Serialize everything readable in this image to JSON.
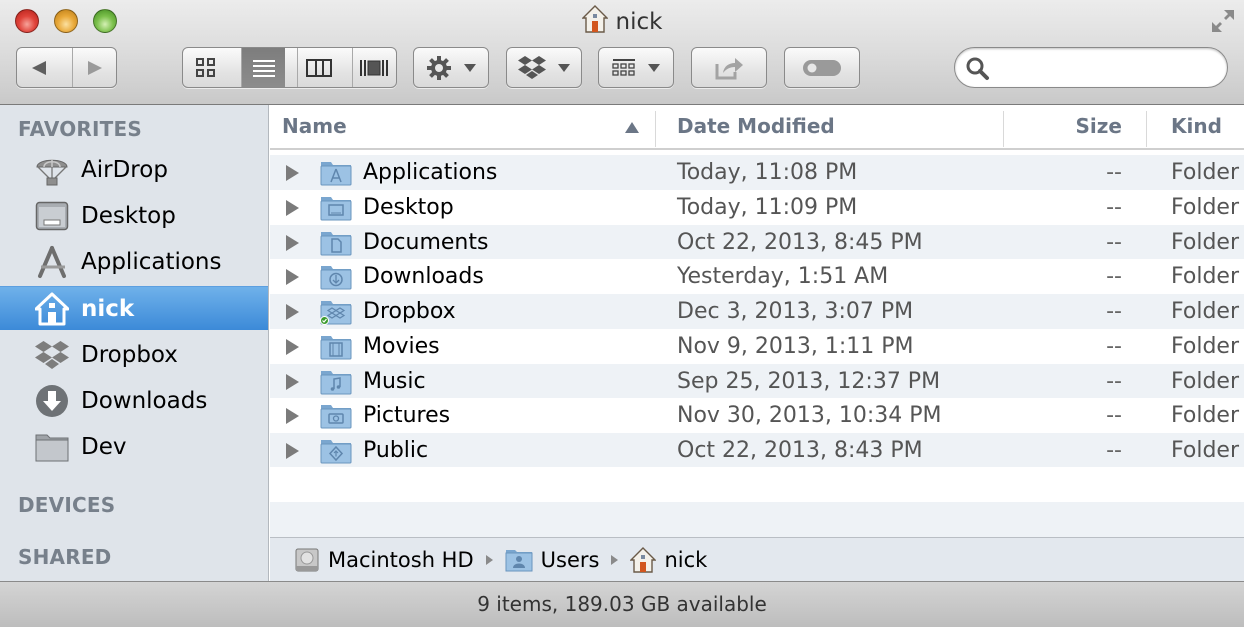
{
  "window": {
    "title": "nick",
    "title_icon": "home-icon"
  },
  "toolbar": {
    "back_icon": "back-arrow-icon",
    "forward_icon": "forward-arrow-icon",
    "view_modes": [
      {
        "name": "icon-view",
        "icon": "grid-icon",
        "active": false
      },
      {
        "name": "list-view",
        "icon": "list-icon",
        "active": true
      },
      {
        "name": "column-view",
        "icon": "columns-icon",
        "active": false
      },
      {
        "name": "cover-flow-view",
        "icon": "cover-flow-icon",
        "active": false
      }
    ],
    "action_menu_icon": "gear-icon",
    "dropbox_menu_icon": "dropbox-icon",
    "arrange_menu_icon": "arrange-grid-icon",
    "share_icon": "share-icon",
    "tags_icon": "toggle-pill-icon",
    "search": {
      "placeholder": "",
      "value": ""
    }
  },
  "sidebar": {
    "sections": {
      "favorites": "FAVORITES",
      "devices": "DEVICES",
      "shared": "SHARED"
    },
    "items": [
      {
        "label": "AirDrop",
        "icon": "airdrop-icon",
        "selected": false
      },
      {
        "label": "Desktop",
        "icon": "desktop-icon",
        "selected": false
      },
      {
        "label": "Applications",
        "icon": "applications-icon",
        "selected": false
      },
      {
        "label": "nick",
        "icon": "home-icon",
        "selected": true
      },
      {
        "label": "Dropbox",
        "icon": "dropbox-icon",
        "selected": false
      },
      {
        "label": "Downloads",
        "icon": "downloads-icon",
        "selected": false
      },
      {
        "label": "Dev",
        "icon": "folder-icon",
        "selected": false
      }
    ]
  },
  "list": {
    "columns": {
      "name": "Name",
      "date_modified": "Date Modified",
      "size": "Size",
      "kind": "Kind"
    },
    "sort": {
      "column": "name",
      "direction": "ascending"
    },
    "rows": [
      {
        "name": "Applications",
        "date": "Today, 11:08 PM",
        "size": "--",
        "kind": "Folder",
        "icon": "applications-folder-icon"
      },
      {
        "name": "Desktop",
        "date": "Today, 11:09 PM",
        "size": "--",
        "kind": "Folder",
        "icon": "desktop-folder-icon"
      },
      {
        "name": "Documents",
        "date": "Oct 22, 2013, 8:45 PM",
        "size": "--",
        "kind": "Folder",
        "icon": "documents-folder-icon"
      },
      {
        "name": "Downloads",
        "date": "Yesterday, 1:51 AM",
        "size": "--",
        "kind": "Folder",
        "icon": "downloads-folder-icon"
      },
      {
        "name": "Dropbox",
        "date": "Dec 3, 2013, 3:07 PM",
        "size": "--",
        "kind": "Folder",
        "icon": "dropbox-folder-icon",
        "synced": true
      },
      {
        "name": "Movies",
        "date": "Nov 9, 2013, 1:11 PM",
        "size": "--",
        "kind": "Folder",
        "icon": "movies-folder-icon"
      },
      {
        "name": "Music",
        "date": "Sep 25, 2013, 12:37 PM",
        "size": "--",
        "kind": "Folder",
        "icon": "music-folder-icon"
      },
      {
        "name": "Pictures",
        "date": "Nov 30, 2013, 10:34 PM",
        "size": "--",
        "kind": "Folder",
        "icon": "pictures-folder-icon"
      },
      {
        "name": "Public",
        "date": "Oct 22, 2013, 8:43 PM",
        "size": "--",
        "kind": "Folder",
        "icon": "public-folder-icon"
      }
    ]
  },
  "pathbar": {
    "crumbs": [
      {
        "label": "Macintosh HD",
        "icon": "hard-drive-icon"
      },
      {
        "label": "Users",
        "icon": "users-folder-icon"
      },
      {
        "label": "nick",
        "icon": "home-icon"
      }
    ]
  },
  "status": {
    "text": "9 items, 189.03 GB available"
  },
  "colors": {
    "selection": "#3c8ad8",
    "sidebar_bg": "#dfe4ea",
    "row_alt": "#eef2f6",
    "header_text": "#6b7686"
  }
}
